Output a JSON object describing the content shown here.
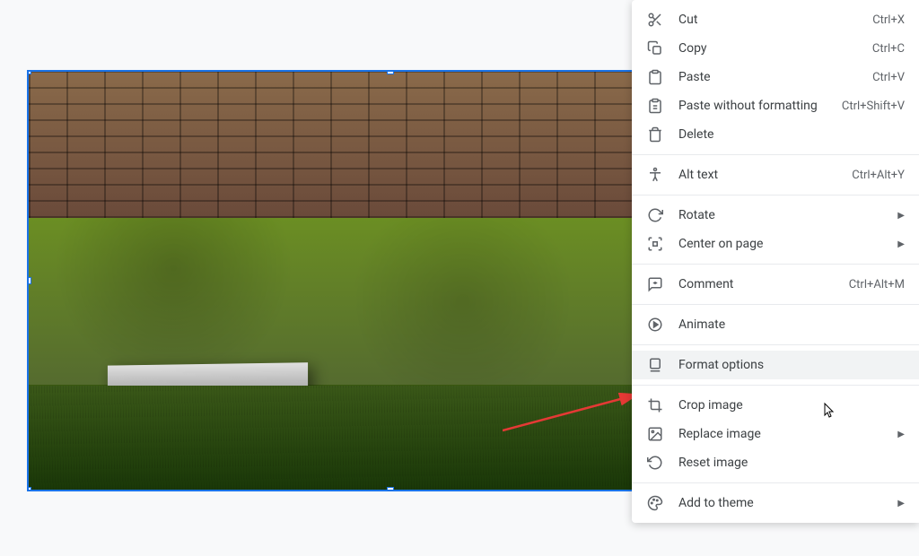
{
  "menu": {
    "cut": {
      "label": "Cut",
      "shortcut": "Ctrl+X"
    },
    "copy": {
      "label": "Copy",
      "shortcut": "Ctrl+C"
    },
    "paste": {
      "label": "Paste",
      "shortcut": "Ctrl+V"
    },
    "paste_nofmt": {
      "label": "Paste without formatting",
      "shortcut": "Ctrl+Shift+V"
    },
    "delete": {
      "label": "Delete"
    },
    "alt_text": {
      "label": "Alt text",
      "shortcut": "Ctrl+Alt+Y"
    },
    "rotate": {
      "label": "Rotate"
    },
    "center": {
      "label": "Center on page"
    },
    "comment": {
      "label": "Comment",
      "shortcut": "Ctrl+Alt+M"
    },
    "animate": {
      "label": "Animate"
    },
    "format_options": {
      "label": "Format options"
    },
    "crop": {
      "label": "Crop image"
    },
    "replace": {
      "label": "Replace image"
    },
    "reset": {
      "label": "Reset image"
    },
    "add_theme": {
      "label": "Add to theme"
    }
  }
}
